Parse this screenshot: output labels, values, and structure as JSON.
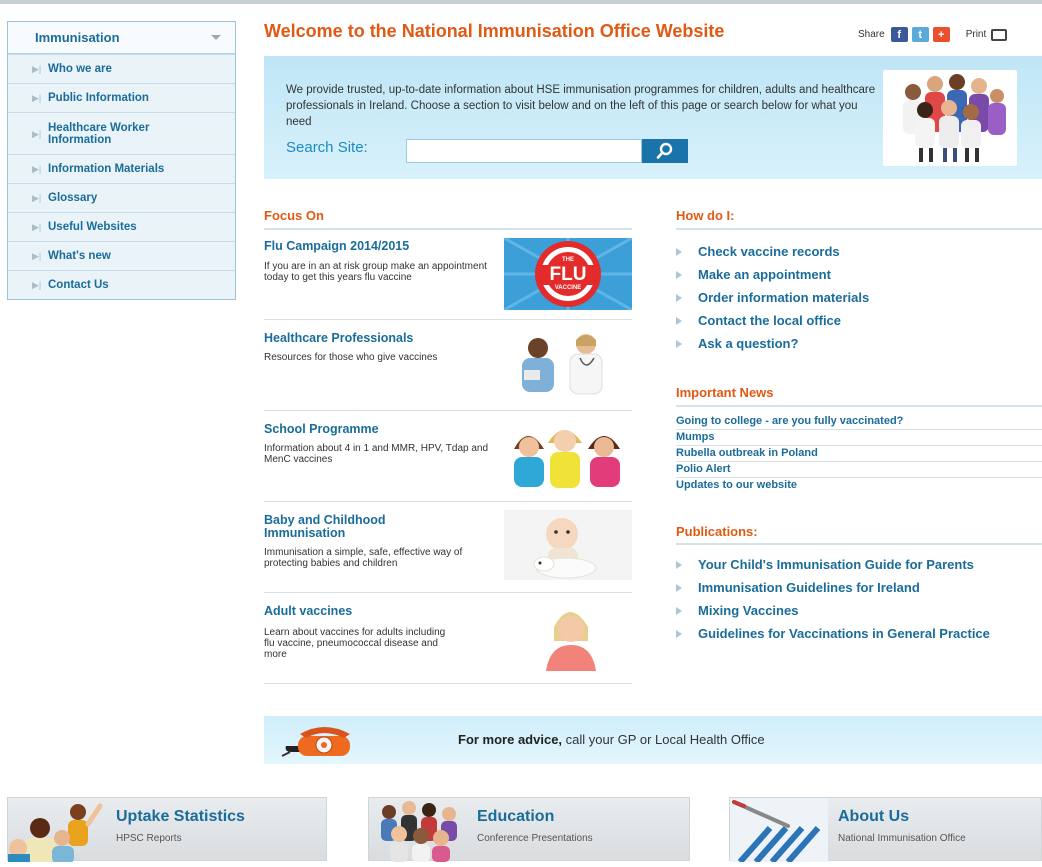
{
  "sidebar": {
    "heading": "Immunisation",
    "items": [
      {
        "label": "Who we are"
      },
      {
        "label": "Public Information"
      },
      {
        "label": "Healthcare Worker Information"
      },
      {
        "label": "Information Materials"
      },
      {
        "label": "Glossary"
      },
      {
        "label": "Useful Websites"
      },
      {
        "label": "What's new"
      },
      {
        "label": "Contact Us"
      }
    ]
  },
  "header": {
    "title": "Welcome to the National Immunisation Office Website",
    "share_label": "Share",
    "print_label": "Print"
  },
  "intro": {
    "text": "We provide trusted, up-to-date information about HSE immunisation programmes for children, adults and healthcare professionals in Ireland. Choose a section to visit below and on the left of this page or search below for what you need",
    "search_label": "Search Site:",
    "search_value": ""
  },
  "focus": {
    "heading": "Focus On",
    "items": [
      {
        "title": "Flu Campaign 2014/2015",
        "desc": "If you are in an at risk group make an appointment today to get this years flu vaccine",
        "badge_top": "THE",
        "badge_main": "FLU",
        "badge_sub": "VACCINE"
      },
      {
        "title": "Healthcare Professionals",
        "desc": "Resources for those who give vaccines"
      },
      {
        "title": "School Programme",
        "desc": "Information about 4 in 1 and MMR, HPV, Tdap and MenC vaccines"
      },
      {
        "title": "Baby and Childhood Immunisation",
        "desc": "Immunisation a simple, safe, effective way of protecting babies and children"
      },
      {
        "title": "Adult vaccines",
        "desc": "Learn about vaccines for adults including flu vaccine, pneumococcal disease and more"
      }
    ]
  },
  "how": {
    "heading": "How do I:",
    "links": [
      "Check vaccine records",
      "Make an appointment",
      "Order information materials",
      "Contact the local office",
      "Ask a question?"
    ]
  },
  "news": {
    "heading": "Important News",
    "items": [
      "Going to college - are you fully vaccinated?",
      "Mumps",
      "Rubella outbreak in Poland",
      "Polio Alert",
      "Updates to our website"
    ]
  },
  "publications": {
    "heading": "Publications:",
    "links": [
      "Your Child's Immunisation Guide for Parents",
      "Immunisation Guidelines for Ireland",
      "Mixing Vaccines",
      "Guidelines for Vaccinations in General Practice"
    ]
  },
  "advice": {
    "bold": "For more advice,",
    "rest": " call your GP or Local Health Office"
  },
  "tiles": [
    {
      "title": "Uptake Statistics",
      "sub": "HPSC Reports"
    },
    {
      "title": "Education",
      "sub": "Conference Presentations"
    },
    {
      "title": "About Us",
      "sub": "National Immunisation Office"
    }
  ],
  "colors": {
    "accent_orange": "#e05a14",
    "link_blue": "#1a6c9a",
    "panel_blue": "#bfe6f6"
  }
}
